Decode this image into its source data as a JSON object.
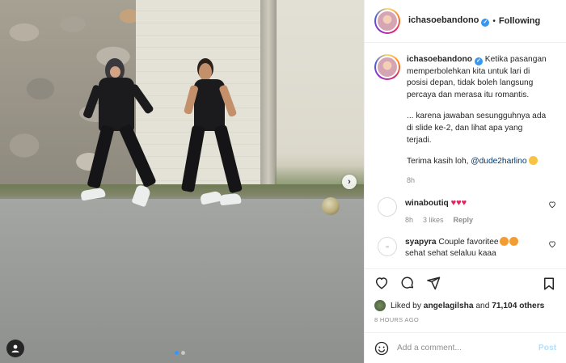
{
  "header": {
    "username": "ichasoebandono",
    "verified": true,
    "follow_status": "Following",
    "separator": "•"
  },
  "caption": {
    "username": "ichasoebandono",
    "paragraphs": [
      "Ketika pasangan memperbolehkan kita untuk lari di posisi depan, tidak boleh langsung percaya dan merasa itu romantis.",
      "... karena jawaban sesungguhnya ada di slide ke-2, dan lihat apa yang terjadi."
    ],
    "thanks_text": "Terima kasih loh, ",
    "mention": "@dude2harlino",
    "time": "8h"
  },
  "comments": [
    {
      "username": "winaboutiq",
      "text": "",
      "emoji": [
        "red-heart",
        "red-heart",
        "red-heart"
      ],
      "time": "8h",
      "likes": "3 likes",
      "reply": "Reply"
    },
    {
      "username": "syapyra",
      "text": "Couple favoritee",
      "text2": "sehat sehat selaluu kaaa",
      "emoji": [
        "heart-eyes",
        "heart-eyes"
      ]
    }
  ],
  "likes": {
    "prefix": "Liked by ",
    "first_liker": "angelagilsha",
    "conjunction": " and ",
    "others": "71,104 others"
  },
  "posted_time": "8 HOURS AGO",
  "add_comment": {
    "placeholder": "Add a comment...",
    "post_label": "Post"
  },
  "carousel": {
    "slides": 2,
    "active": 1
  },
  "colors": {
    "verified_blue": "#3897f0",
    "link_blue": "#00376b",
    "muted_gray": "#8e8e8e",
    "post_button_disabled": "#b2dffc",
    "heart_red": "#e0245e"
  }
}
